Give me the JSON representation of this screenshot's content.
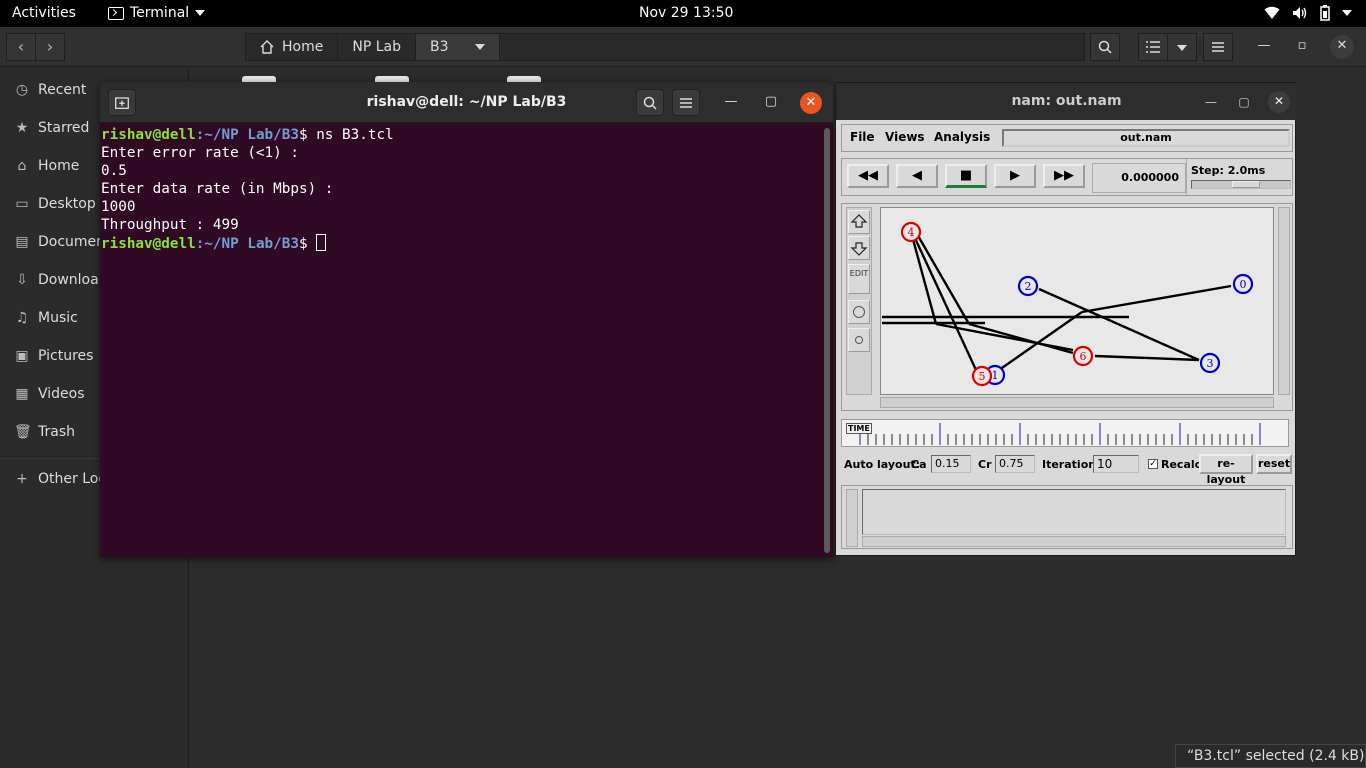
{
  "topbar": {
    "activities": "Activities",
    "app_name": "Terminal",
    "clock": "Nov 29  13:50"
  },
  "filemanager": {
    "breadcrumbs": [
      "Home",
      "NP Lab",
      "B3"
    ],
    "sidebar": [
      {
        "label": "Recent",
        "icon": "clock-icon"
      },
      {
        "label": "Starred",
        "icon": "star-icon"
      },
      {
        "label": "Home",
        "icon": "home-icon"
      },
      {
        "label": "Desktop",
        "icon": "desktop-icon"
      },
      {
        "label": "Documen",
        "icon": "document-icon"
      },
      {
        "label": "Downloa",
        "icon": "download-icon"
      },
      {
        "label": "Music",
        "icon": "music-icon"
      },
      {
        "label": "Pictures",
        "icon": "picture-icon"
      },
      {
        "label": "Videos",
        "icon": "video-icon"
      },
      {
        "label": "Trash",
        "icon": "trash-icon"
      },
      {
        "label": "Other Loc",
        "icon": "plus-icon"
      }
    ],
    "status": "“B3.tcl” selected  (2.4 kB)"
  },
  "terminal": {
    "title": "rishav@dell: ~/NP Lab/B3",
    "prompt_user": "rishav@dell",
    "prompt_path": ":~/NP Lab/B3",
    "prompt_symbol": "$ ",
    "command": "ns B3.tcl",
    "output": [
      "Enter error rate (<1) :",
      "0.5",
      "Enter data rate (in Mbps) :",
      "1000",
      "Throughput : 499"
    ]
  },
  "nam": {
    "title": "nam: out.nam",
    "menu": {
      "file": "File",
      "views": "Views",
      "analysis": "Analysis"
    },
    "filename": "out.nam",
    "time": "0.000000",
    "step": "Step: 2.0ms",
    "tool_edit": "EDIT",
    "timeline_label": "TIME",
    "layout": {
      "auto_layout": "Auto layout:",
      "ca_label": "Ca",
      "ca_value": "0.15",
      "cr_label": "Cr",
      "cr_value": "0.75",
      "iter_label": "Iterations",
      "iter_value": "10",
      "recalc": "Recalc",
      "relayout": "re-layout",
      "reset": "reset"
    },
    "nodes": [
      {
        "id": "0",
        "color": "#0000cc"
      },
      {
        "id": "1",
        "color": "#0000cc"
      },
      {
        "id": "2",
        "color": "#0000cc"
      },
      {
        "id": "3",
        "color": "#0000cc"
      },
      {
        "id": "4",
        "color": "#dd0000"
      },
      {
        "id": "5",
        "color": "#dd0000"
      },
      {
        "id": "6",
        "color": "#dd0000"
      }
    ]
  }
}
